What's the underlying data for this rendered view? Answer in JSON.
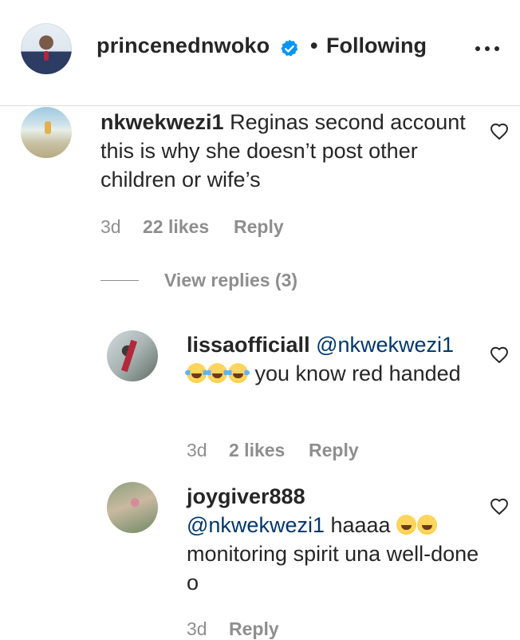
{
  "post": {
    "username": "princenednwoko",
    "separator": "•",
    "follow_status": "Following"
  },
  "comments": [
    {
      "username": "nkwekwezi1",
      "text": "Reginas second account this is why she doesn’t post other children or wife’s",
      "age": "3d",
      "likes": "22 likes",
      "reply": "Reply"
    }
  ],
  "view_replies": "View replies (3)",
  "replies": [
    {
      "username": "lissaofficiall",
      "mention": "@nkwekwezi1",
      "text_after_emoji": " you know red handed",
      "emoji": "😂😂😂",
      "age": "3d",
      "likes": "2 likes",
      "reply": "Reply"
    },
    {
      "username": "joygiver888",
      "mention": "@nkwekwezi1",
      "text_before_emoji": " haaaa ",
      "emoji": "😁😁",
      "text_after_emoji": " monitoring spirit una well-done o",
      "age": "3d",
      "reply": "Reply"
    }
  ],
  "colors": {
    "text": "#262626",
    "muted": "#8e8e8e",
    "mention": "#00376b",
    "verified": "#0095f6",
    "divider": "#dbdbdb"
  },
  "icons": {
    "verified": "verified-badge-icon",
    "more": "more-options-icon",
    "like": "heart-outline-icon"
  }
}
